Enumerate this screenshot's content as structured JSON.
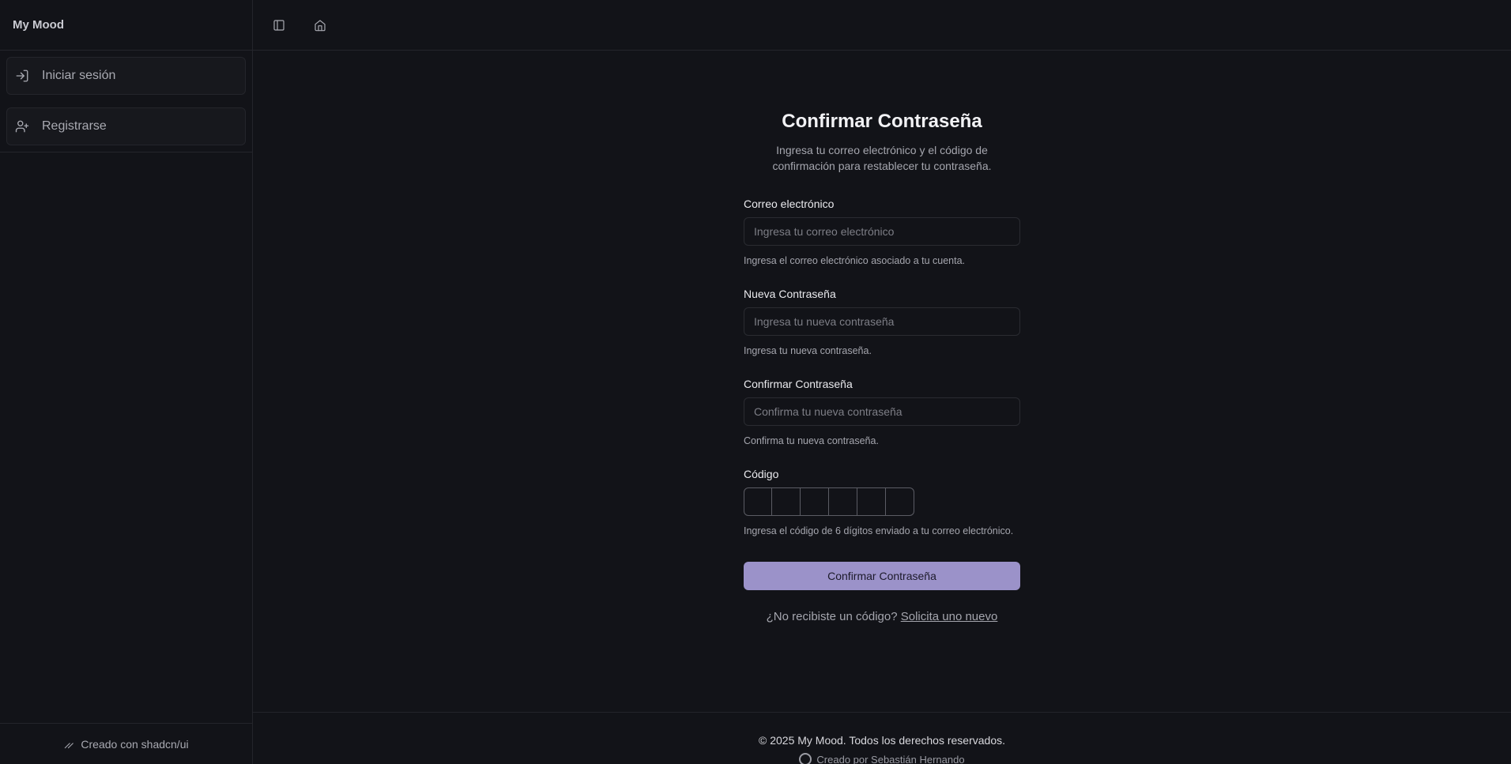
{
  "app": {
    "title": "My Mood"
  },
  "sidebar": {
    "items": [
      {
        "label": "Iniciar sesión",
        "icon": "log-in-icon"
      },
      {
        "label": "Registrarse",
        "icon": "user-plus-icon"
      }
    ],
    "footer": "Creado con shadcn/ui"
  },
  "topbar": {
    "icons": [
      "sidebar-toggle-icon",
      "home-icon"
    ]
  },
  "form": {
    "title": "Confirmar Contraseña",
    "subtitle": "Ingresa tu correo electrónico y el código de confirmación para restablecer tu contraseña.",
    "email": {
      "label": "Correo electrónico",
      "placeholder": "Ingresa tu correo electrónico",
      "value": "",
      "help": "Ingresa el correo electrónico asociado a tu cuenta."
    },
    "new_password": {
      "label": "Nueva Contraseña",
      "placeholder": "Ingresa tu nueva contraseña",
      "value": "",
      "help": "Ingresa tu nueva contraseña."
    },
    "confirm_password": {
      "label": "Confirmar Contraseña",
      "placeholder": "Confirma tu nueva contraseña",
      "value": "",
      "help": "Confirma tu nueva contraseña."
    },
    "code": {
      "label": "Código",
      "help": "Ingresa el código de 6 dígitos enviado a tu correo electrónico."
    },
    "submit_label": "Confirmar Contraseña",
    "resend_prefix": "¿No recibiste un código?",
    "resend_link": "Solicita uno nuevo"
  },
  "footer": {
    "copyright": "© 2025 My Mood. Todos los derechos reservados.",
    "author": "Creado por Sebastián Hernando"
  },
  "colors": {
    "background": "#121318",
    "accent": "#9b92c9",
    "border": "#24252b"
  }
}
